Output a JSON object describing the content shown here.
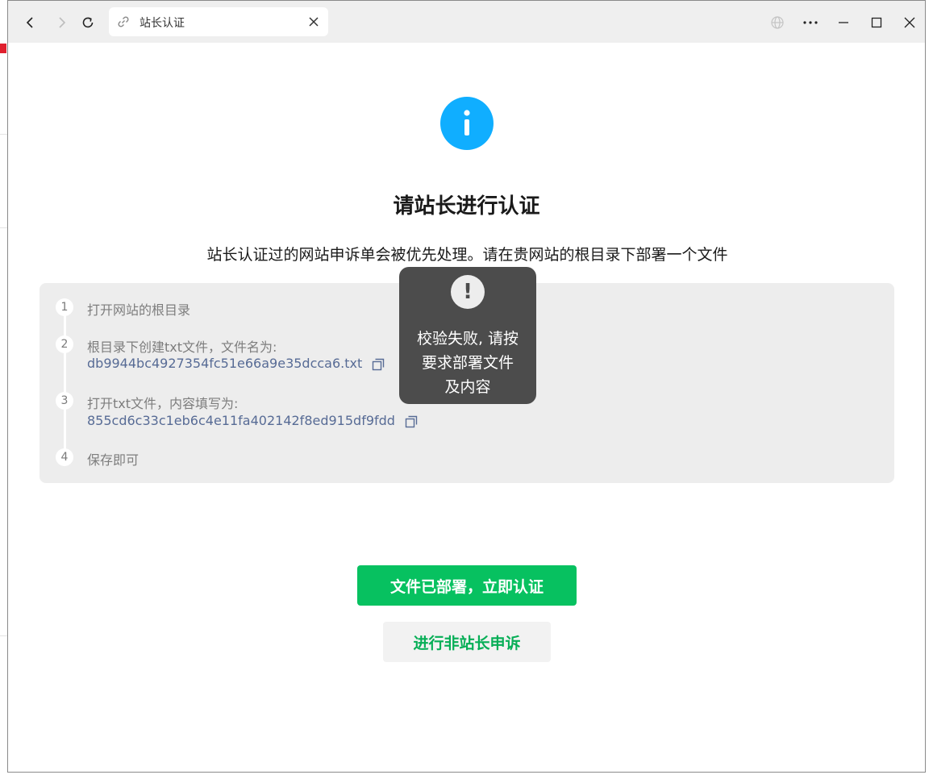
{
  "browser": {
    "tab_title": "站长认证"
  },
  "page": {
    "title": "请站长进行认证",
    "description": "站长认证过的网站申诉单会被优先处理。请在贵网站的根目录下部署一个文件"
  },
  "steps": [
    {
      "number": "1",
      "text": "打开网站的根目录"
    },
    {
      "number": "2",
      "text": "根目录下创建txt文件，文件名为:",
      "value": "db9944bc4927354fc51e66a9e35dcca6.txt"
    },
    {
      "number": "3",
      "text": "打开txt文件，内容填写为:",
      "value": "855cd6c33c1eb6c4e11fa402142f8ed915df9fdd"
    },
    {
      "number": "4",
      "text": "保存即可"
    }
  ],
  "toast": {
    "icon_symbol": "!",
    "line1": "校验失败, 请按",
    "line2": "要求部署文件",
    "line3": "及内容"
  },
  "actions": {
    "primary_label": "文件已部署，立即认证",
    "secondary_label": "进行非站长申诉"
  },
  "colors": {
    "primary": "#07c160",
    "link": "#576b95",
    "info": "#10aeff",
    "toast_bg": "#4c4c4c"
  }
}
